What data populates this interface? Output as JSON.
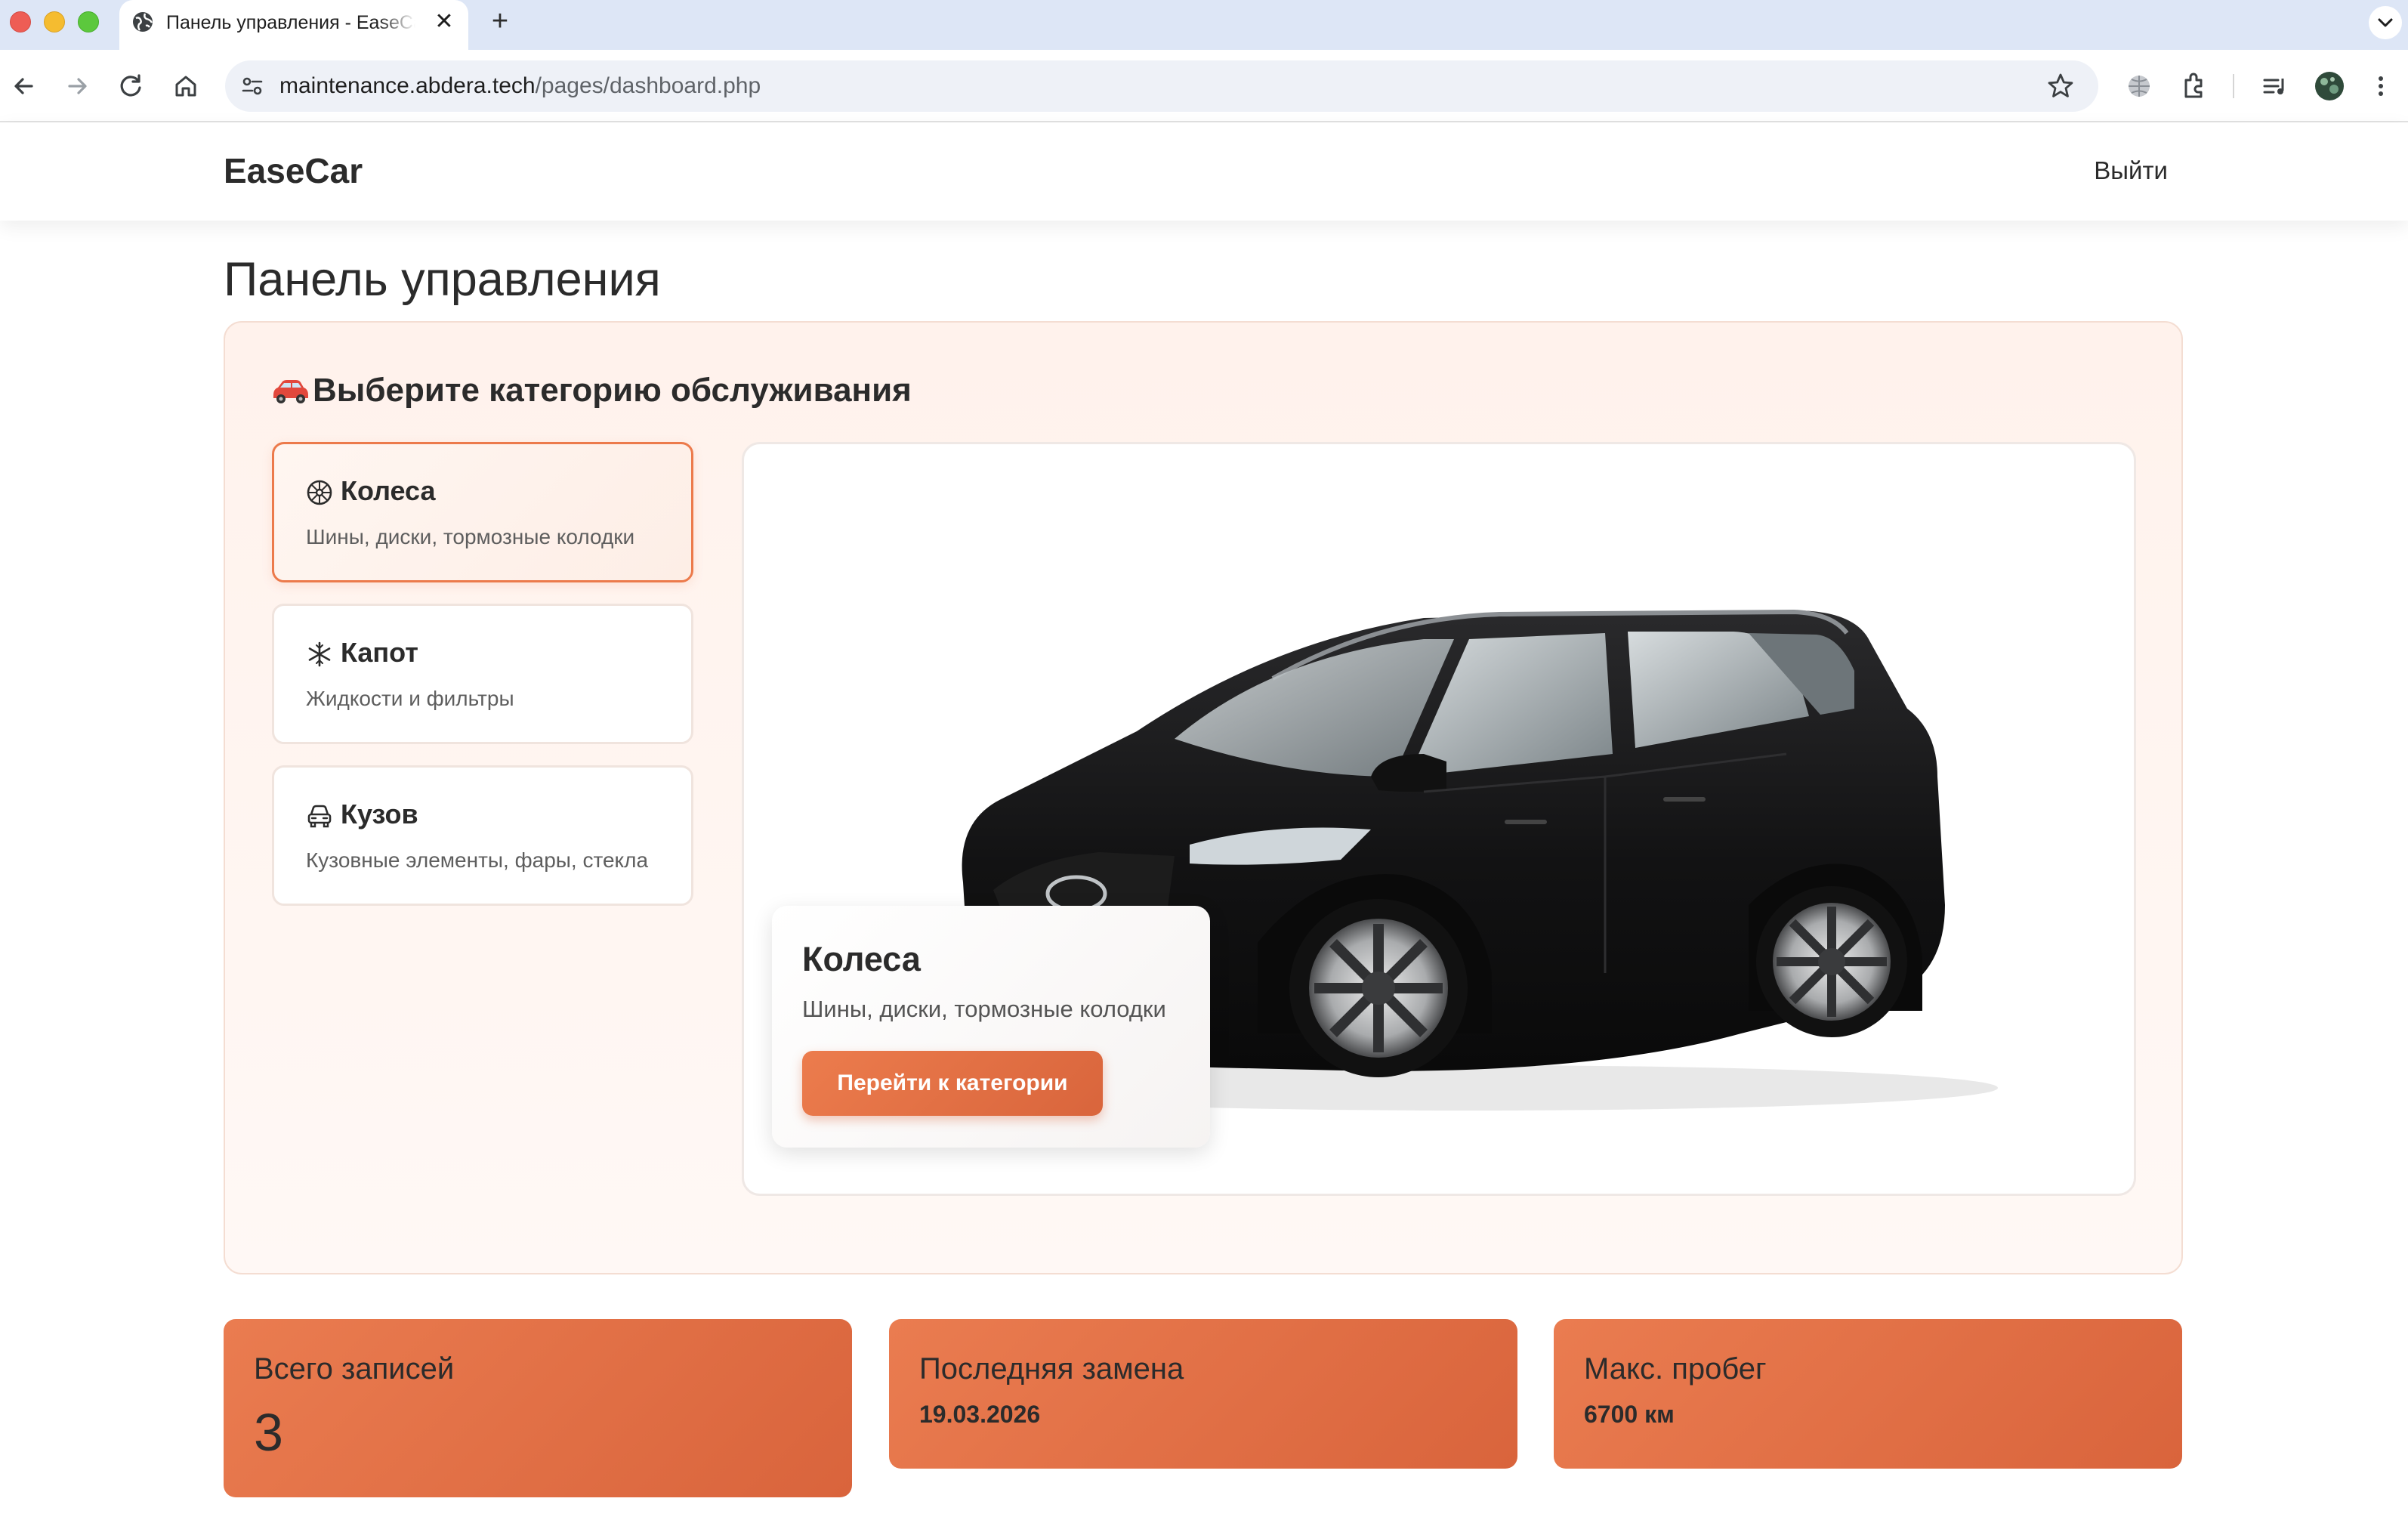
{
  "browser": {
    "tab_title": "Панель управления - EaseCar",
    "url_domain": "maintenance.abdera.tech",
    "url_path": "/pages/dashboard.php"
  },
  "header": {
    "logo": "EaseCar",
    "logout": "Выйти"
  },
  "page": {
    "title": "Панель управления"
  },
  "panel": {
    "title": "Выберите категорию обслуживания",
    "title_icon": "car-emoji",
    "categories": [
      {
        "icon": "wheel-icon",
        "name": "Колеса",
        "desc": "Шины, диски, тормозные колодки",
        "active": true
      },
      {
        "icon": "snowflake-icon",
        "name": "Капот",
        "desc": "Жидкости и фильтры",
        "active": false
      },
      {
        "icon": "car-body-icon",
        "name": "Кузов",
        "desc": "Кузовные элементы, фары, стекла",
        "active": false
      }
    ],
    "preview": {
      "title": "Колеса",
      "desc": "Шины, диски, тормозные колодки",
      "button": "Перейти к категории"
    }
  },
  "stats": [
    {
      "label": "Всего записей",
      "value": "3"
    },
    {
      "label": "Последняя замена",
      "value": "19.03.2026"
    },
    {
      "label": "Макс. пробег",
      "value": "6700 км"
    }
  ],
  "colors": {
    "accent": "#e8744a",
    "accent_dark": "#d9643c",
    "panel_bg": "#fff4ef"
  }
}
